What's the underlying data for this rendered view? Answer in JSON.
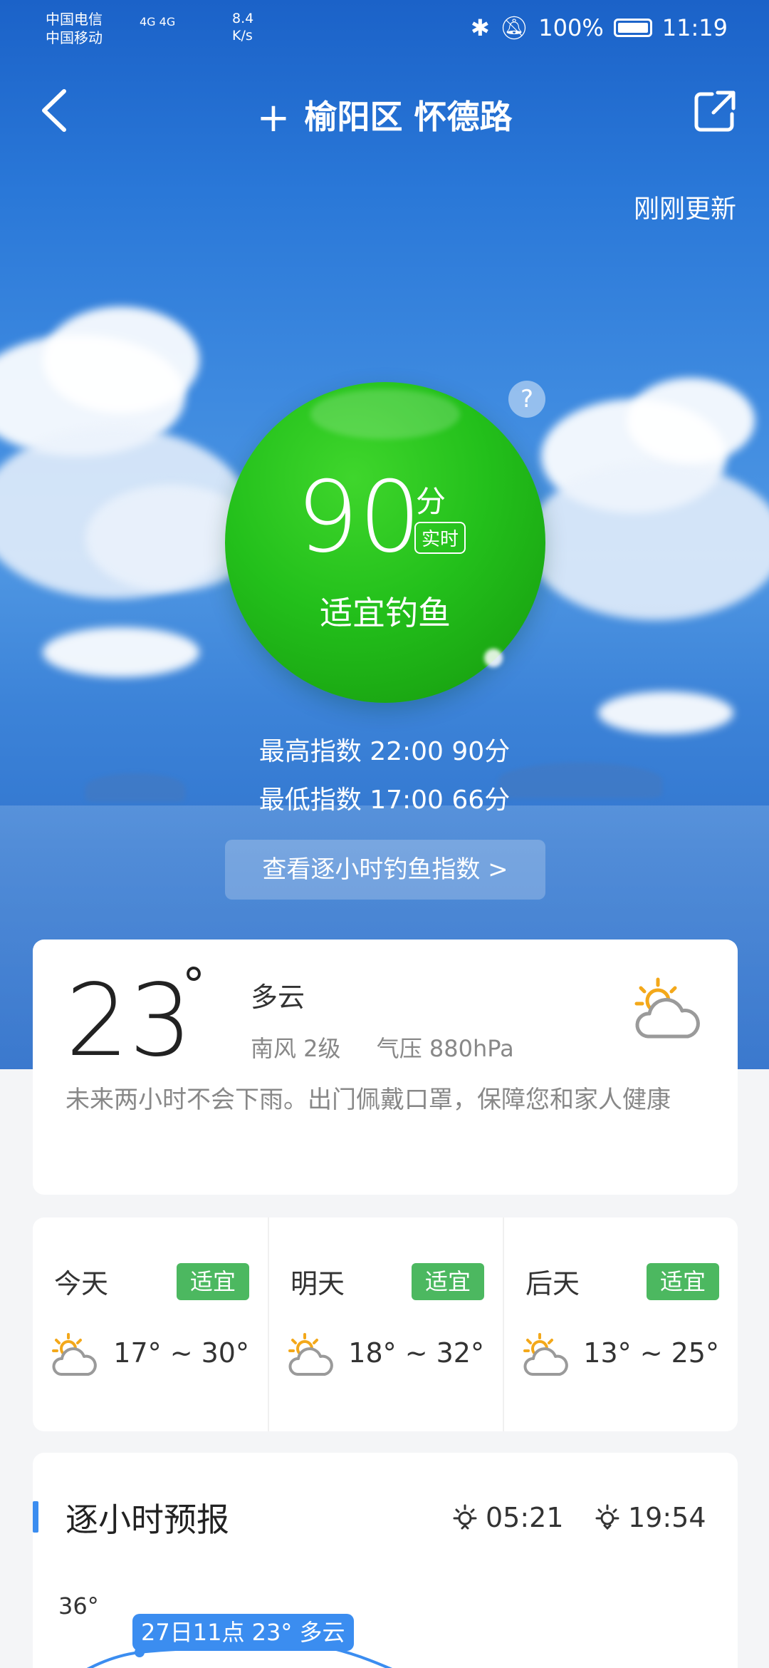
{
  "status_bar": {
    "carrier1": "中国电信",
    "carrier2": "中国移动",
    "net": "4G 4G",
    "speed_value": "8.4",
    "speed_unit": "K/s",
    "battery": "100%",
    "time": "11:19"
  },
  "nav": {
    "add_icon": "plus-icon",
    "location": "榆阳区 怀德路",
    "back_icon": "chevron-left-icon",
    "share_icon": "share-icon"
  },
  "updated": "刚刚更新",
  "index": {
    "score": "90",
    "unit": "分",
    "tag": "实时",
    "label": "适宜钓鱼",
    "help": "?",
    "max": "最高指数  22:00  90分",
    "min": "最低指数  17:00  66分",
    "hourly_link": "查看逐小时钓鱼指数 >"
  },
  "current": {
    "temp": "23",
    "deg": "°",
    "condition": "多云",
    "wind": "南风  2级",
    "pressure": "气压  880hPa",
    "desc": "未来两小时不会下雨。出门佩戴口罩，保障您和家人健康",
    "icon": "partly-cloudy-icon"
  },
  "forecast": [
    {
      "day": "今天",
      "tag": "适宜",
      "range": "17° ~ 30°",
      "icon": "partly-cloudy-icon"
    },
    {
      "day": "明天",
      "tag": "适宜",
      "range": "18° ~ 32°",
      "icon": "partly-cloudy-icon"
    },
    {
      "day": "后天",
      "tag": "适宜",
      "range": "13° ~ 25°",
      "icon": "partly-cloudy-icon"
    }
  ],
  "hourly": {
    "title": "逐小时预报",
    "sunrise": "05:21",
    "sunset": "19:54",
    "ytick": "36°",
    "label": "27日11点 23° 多云"
  },
  "colors": {
    "sky": "#2a78d8",
    "index_green": "#23c01b",
    "tag_green": "#4cb860",
    "accent_blue": "#3b8df0"
  }
}
